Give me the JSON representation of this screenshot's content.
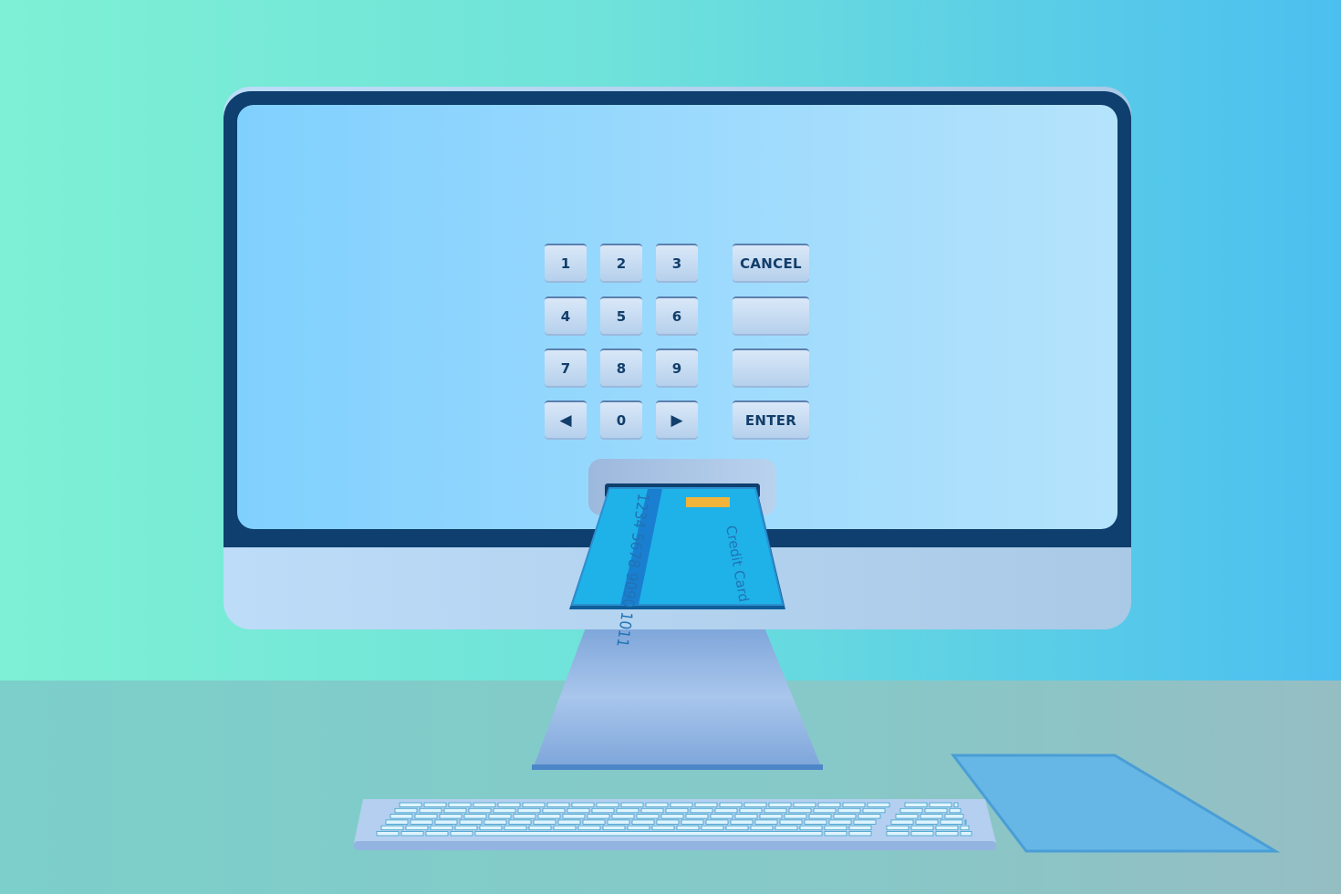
{
  "keypad": {
    "digits": [
      {
        "label": "1"
      },
      {
        "label": "2"
      },
      {
        "label": "3"
      },
      {
        "label": "4"
      },
      {
        "label": "5"
      },
      {
        "label": "6"
      },
      {
        "label": "7"
      },
      {
        "label": "8"
      },
      {
        "label": "9"
      },
      {
        "icon": "arrow-left-icon"
      },
      {
        "label": "0"
      },
      {
        "icon": "arrow-right-icon"
      }
    ],
    "cancel_label": "CANCEL",
    "enter_label": "ENTER"
  },
  "card": {
    "number": "1234 5678 9090 1011",
    "label": "Credit Card"
  },
  "colors": {
    "bezel": "#0e3f6e",
    "screen": "#8fd6fd",
    "card": "#1fb2e8",
    "chip": "#f2b43a"
  }
}
